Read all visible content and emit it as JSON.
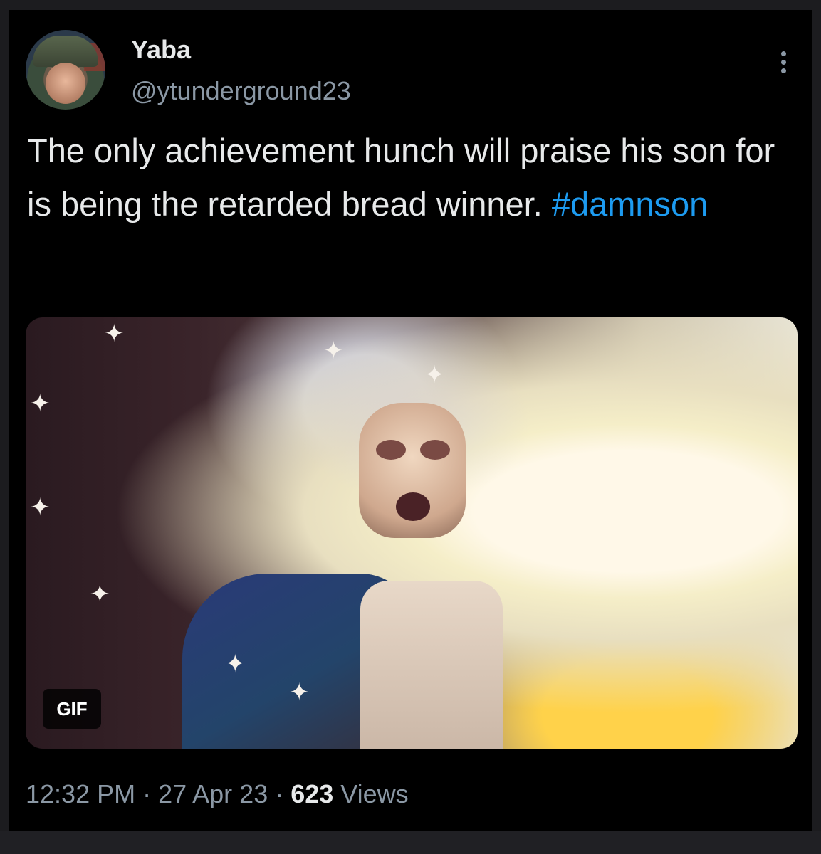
{
  "tweet": {
    "display_name": "Yaba",
    "handle": "@ytunderground23",
    "text_main": "The only achievement hunch will praise his son for is being the retarded bread winner. ",
    "hashtag": "#damnson",
    "media": {
      "badge": "GIF"
    },
    "time": "12:32 PM",
    "date": "27 Apr 23",
    "separator": " · ",
    "views_count": "623",
    "views_label": " Views"
  },
  "icons": {
    "more": "more-options-icon"
  },
  "colors": {
    "background": "#000000",
    "text": "#e7e9ea",
    "secondary": "#8b98a5",
    "link": "#1d9bf0"
  }
}
